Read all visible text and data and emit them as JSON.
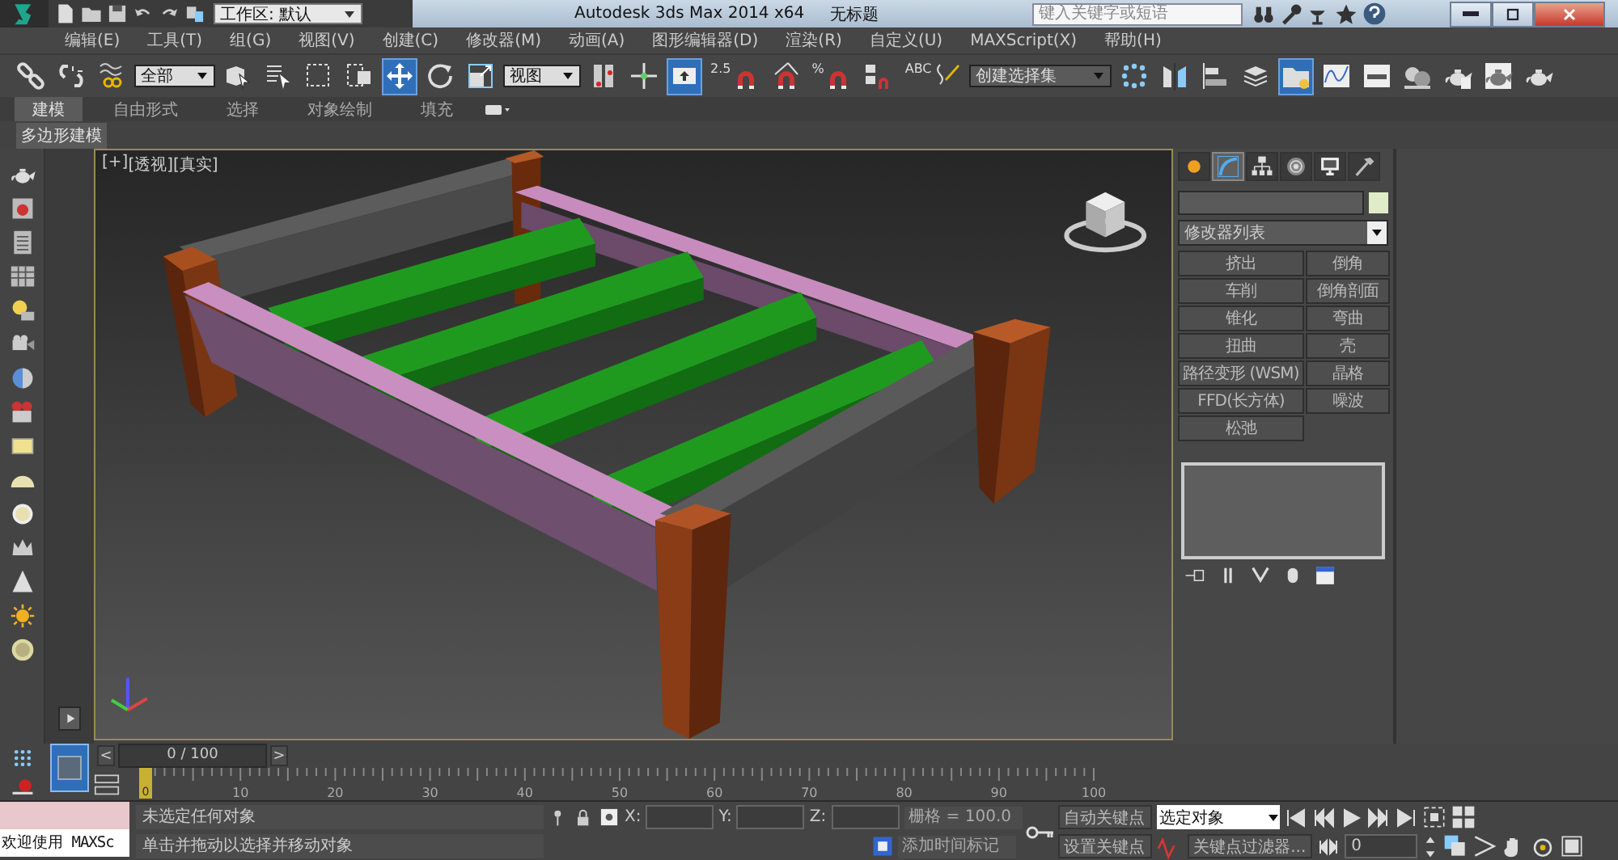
{
  "title_bar": {
    "workspace": "工作区: 默认",
    "title": "Autodesk 3ds Max  2014 x64",
    "document": "无标题",
    "search": {
      "placeholder": "键入关键字或短语"
    }
  },
  "menu": [
    "编辑(E)",
    "工具(T)",
    "组(G)",
    "视图(V)",
    "创建(C)",
    "修改器(M)",
    "动画(A)",
    "图形编辑器(D)",
    "渲染(R)",
    "自定义(U)",
    "MAXScript(X)",
    "帮助(H)"
  ],
  "toolbar": [
    {
      "kind": "link",
      "selected": false
    },
    {
      "kind": "unlink",
      "selected": false
    },
    {
      "kind": "bind",
      "selected": false
    },
    {
      "kind": "dropdown",
      "value": "全部"
    },
    {
      "kind": "select",
      "selected": false
    },
    {
      "kind": "namelist",
      "selected": false
    },
    {
      "kind": "region",
      "selected": false
    },
    {
      "kind": "crossing",
      "selected": false
    },
    {
      "kind": "move",
      "selected": true
    },
    {
      "kind": "rotate",
      "selected": false
    },
    {
      "kind": "scale",
      "selected": false
    },
    {
      "kind": "dropdown",
      "value": "视图"
    },
    {
      "kind": "pivot",
      "selected": false
    },
    {
      "kind": "manipulate",
      "selected": false
    },
    {
      "kind": "shortcut",
      "selected": true
    },
    {
      "kind": "snap",
      "label": "2.5",
      "selected": false
    },
    {
      "kind": "anglesnap",
      "selected": false
    },
    {
      "kind": "percentsnap",
      "label": "%",
      "selected": false
    },
    {
      "kind": "spinner",
      "selected": false
    },
    {
      "kind": "namedsel",
      "label": "ABC",
      "selected": false
    },
    {
      "kind": "dropdown",
      "value": "创建选择集"
    },
    {
      "kind": "array",
      "selected": false
    },
    {
      "kind": "mirror",
      "selected": false
    },
    {
      "kind": "align",
      "selected": false
    },
    {
      "kind": "layers",
      "selected": false
    },
    {
      "kind": "explorer",
      "selected": true
    },
    {
      "kind": "curve",
      "selected": false
    },
    {
      "kind": "schematic",
      "selected": false
    },
    {
      "kind": "material",
      "selected": false
    },
    {
      "kind": "rendersetup",
      "selected": false
    },
    {
      "kind": "frame",
      "selected": false
    },
    {
      "kind": "render",
      "selected": false
    }
  ],
  "ribbon": {
    "tabs": [
      {
        "label": "建模",
        "selected": true
      },
      {
        "label": "自由形式",
        "selected": false
      },
      {
        "label": "选择",
        "selected": false
      },
      {
        "label": "对象绘制",
        "selected": false
      },
      {
        "label": "填充",
        "selected": false
      }
    ],
    "panel": "多边形建模"
  },
  "viewport": {
    "labels": [
      "[+]",
      "[透视]",
      "[真实]"
    ]
  },
  "command_panel": {
    "tabs": [
      {
        "kind": "create",
        "selected": false
      },
      {
        "kind": "modify",
        "selected": true
      },
      {
        "kind": "hierarchy",
        "selected": false
      },
      {
        "kind": "motion",
        "selected": false
      },
      {
        "kind": "display",
        "selected": false
      },
      {
        "kind": "utilities",
        "selected": false
      }
    ],
    "modifier_list": "修改器列表",
    "modifiers": [
      "挤出",
      "倒角",
      "车削",
      "倒角剖面",
      "锥化",
      "弯曲",
      "扭曲",
      "壳",
      "路径变形 (WSM)",
      "晶格",
      "FFD(长方体)",
      "噪波",
      "松弛"
    ]
  },
  "timeline": {
    "frame": "0 / 100",
    "prev": "<",
    "next": ">",
    "marker": "0",
    "ticks": [
      "10",
      "20",
      "30",
      "40",
      "50",
      "60",
      "70",
      "80",
      "90",
      "100"
    ]
  },
  "status": {
    "listener": "欢迎使用 MAXSc",
    "selection": "未选定任何对象",
    "prompt": "单击并拖动以选择并移动对象",
    "coords": [
      "X:",
      "Y:",
      "Z:"
    ],
    "grid": "栅格 = 100.0",
    "auto_key": "自动关键点",
    "key_mode": "选定对象",
    "set_key": "设置关键点",
    "key_filters": "关键点过滤器...",
    "frame": "0",
    "time_tag": "添加时间标记"
  }
}
